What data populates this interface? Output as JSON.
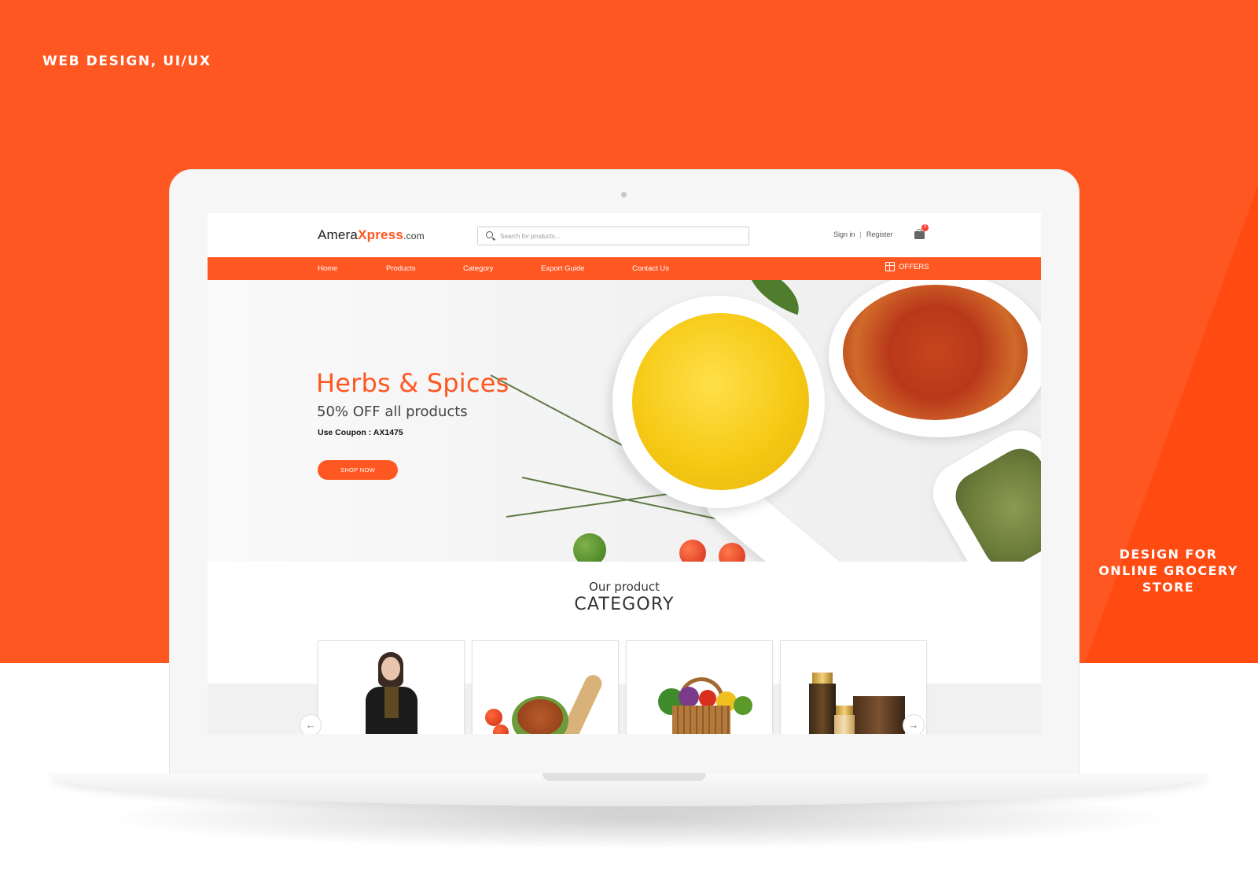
{
  "poster": {
    "tag_top": "WEB DESIGN, UI/UX",
    "tag_right": [
      "DESIGN FOR",
      "ONLINE GROCERY",
      "STORE"
    ],
    "colors": {
      "brand": "#ff5722",
      "text_dark": "#333333"
    }
  },
  "site": {
    "logo": {
      "part1": "Amera",
      "part2": "Xpress",
      "part3": ".com"
    },
    "search": {
      "placeholder": "Search for products..."
    },
    "auth": {
      "sign_in": "Sign in",
      "separator": "|",
      "register": "Register"
    },
    "cart": {
      "icon": "shopping-bag-icon",
      "count": "3"
    },
    "nav": {
      "items": [
        "Home",
        "Products",
        "Category",
        "Export Guide",
        "Contact Us"
      ],
      "offers": "OFFERS",
      "offers_icon": "gift-icon"
    },
    "hero": {
      "title": "Herbs & Spices",
      "subtitle": "50% OFF all products",
      "coupon": "Use Coupon : AX1475",
      "button": "SHOP NOW"
    },
    "category": {
      "subtitle": "Our product",
      "title": "CATEGORY",
      "prev_icon": "arrow-left-icon",
      "next_icon": "arrow-right-icon",
      "cards": [
        {
          "name": "clothing"
        },
        {
          "name": "spices"
        },
        {
          "name": "vegetables"
        },
        {
          "name": "cosmetics"
        }
      ]
    }
  }
}
